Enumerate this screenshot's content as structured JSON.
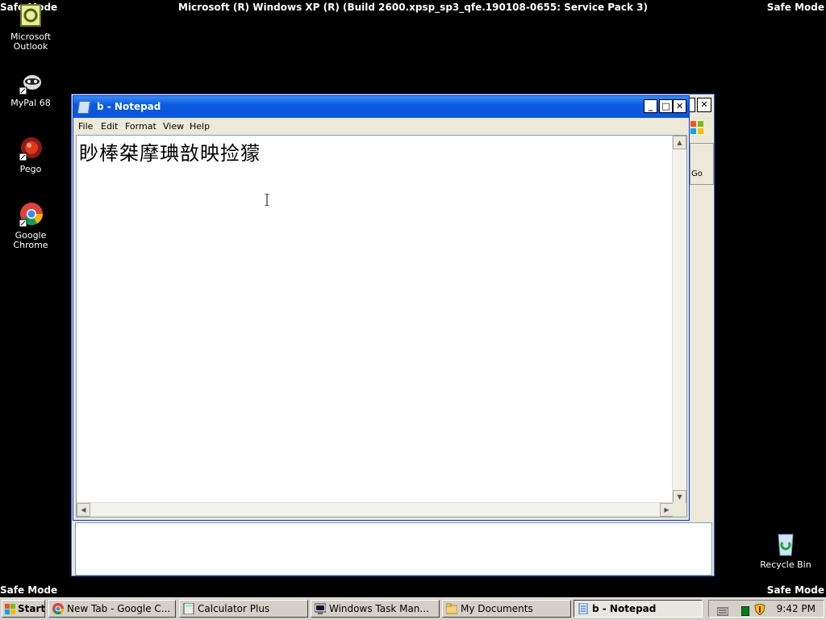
{
  "screen": {
    "safe_mode": "Safe Mode",
    "build_banner": "Microsoft (R) Windows XP (R) (Build 2600.xpsp_sp3_qfe.190108-0655: Service Pack 3)"
  },
  "desktop": {
    "icons": [
      {
        "label": "Microsoft Outlook",
        "icon": "outlook-icon"
      },
      {
        "label": "MyPal 68",
        "icon": "mypal-icon"
      },
      {
        "label": "Pego",
        "icon": "pego-icon"
      },
      {
        "label": "Google Chrome",
        "icon": "chrome-icon"
      },
      {
        "label": "Recycle Bin",
        "icon": "recycle-bin-icon"
      }
    ]
  },
  "background_window": {
    "go_label": "Go"
  },
  "notepad": {
    "title": "b - Notepad",
    "menu": [
      "File",
      "Edit",
      "Format",
      "View",
      "Help"
    ],
    "content": "眇棒桀摩琠敨映捡獴"
  },
  "taskbar": {
    "start_label": "Start",
    "tasks": [
      {
        "label": "New Tab - Google C...",
        "icon": "chrome-icon",
        "active": false
      },
      {
        "label": "Calculator Plus",
        "icon": "calculator-icon",
        "active": false
      },
      {
        "label": "Windows Task Man...",
        "icon": "task-manager-icon",
        "active": false
      },
      {
        "label": "My Documents",
        "icon": "folder-icon",
        "active": false
      },
      {
        "label": "b - Notepad",
        "icon": "notepad-icon",
        "active": true
      }
    ],
    "clock": "9:42 PM"
  },
  "colors": {
    "titlebar": "#0a5ae0",
    "desktop": "#000000",
    "taskbar": "#d4d0c8"
  }
}
